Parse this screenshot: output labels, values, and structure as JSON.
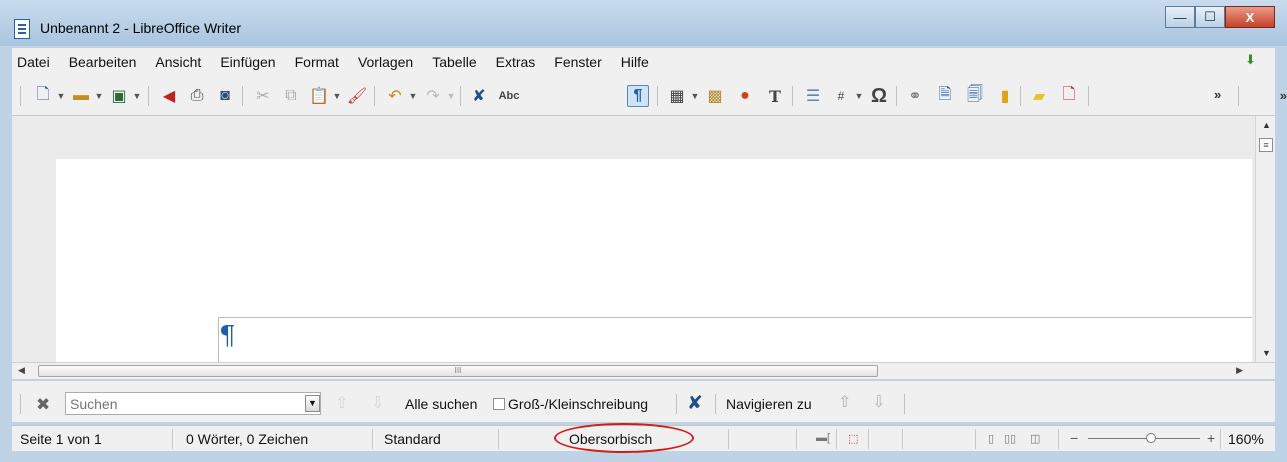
{
  "window": {
    "title": "Unbenannt 2 - LibreOffice Writer",
    "buttons": {
      "minimize": "—",
      "maximize": "☐",
      "close": "X"
    }
  },
  "menubar": {
    "items": [
      "Datei",
      "Bearbeiten",
      "Ansicht",
      "Einfügen",
      "Format",
      "Vorlagen",
      "Tabelle",
      "Extras",
      "Fenster",
      "Hilfe"
    ]
  },
  "toolbar": {
    "more": "»",
    "icons": [
      "new-document-icon",
      "open-folder-icon",
      "save-icon",
      "export-pdf-icon",
      "print-icon",
      "print-preview-icon",
      "cut-icon",
      "copy-icon",
      "paste-icon",
      "clone-formatting-icon",
      "undo-icon",
      "redo-icon",
      "find-replace-icon",
      "spellcheck-icon",
      "formatting-marks-icon",
      "table-icon",
      "image-icon",
      "chart-icon",
      "text-box-icon",
      "page-break-icon",
      "field-icon",
      "special-character-icon",
      "hyperlink-icon",
      "footnote-icon",
      "endnote-icon",
      "bookmark-icon",
      "comment-icon",
      "track-changes-icon"
    ]
  },
  "document": {
    "pilcrow": "¶"
  },
  "hscroll": {
    "grip": "III"
  },
  "findbar": {
    "placeholder": "Suchen",
    "find_all": "Alle suchen",
    "match_case": "Groß-/Kleinschreibung",
    "navigate_to": "Navigieren zu"
  },
  "statusbar": {
    "page": "Seite 1 von 1",
    "words": "0 Wörter, 0 Zeichen",
    "page_style": "Standard",
    "language": "Obersorbisch",
    "zoom_minus": "−",
    "zoom_plus": "+",
    "zoom": "160%",
    "zoom_level_fraction": 0.5
  },
  "colors": {
    "highlight_ellipse": "#d11c1c",
    "pilcrow": "#1e5fa8"
  }
}
